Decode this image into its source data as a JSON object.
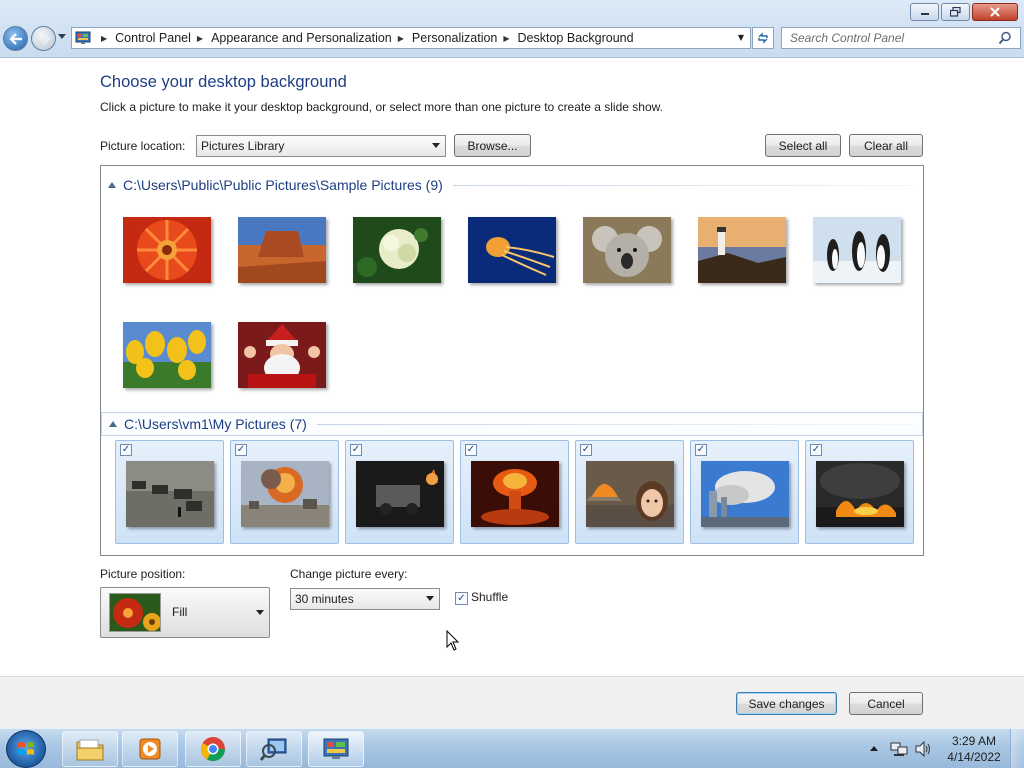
{
  "window": {
    "minimize_label": "Minimize",
    "maximize_label": "Restore",
    "close_label": "Close"
  },
  "address_bar": {
    "breadcrumbs": [
      "Control Panel",
      "Appearance and Personalization",
      "Personalization",
      "Desktop Background"
    ]
  },
  "search": {
    "placeholder": "Search Control Panel"
  },
  "page": {
    "title": "Choose your desktop background",
    "subtitle": "Click a picture to make it your desktop background, or select more than one picture to create a slide show."
  },
  "picture_location": {
    "label": "Picture location:",
    "value": "Pictures Library",
    "browse_label": "Browse...",
    "select_all_label": "Select all",
    "clear_all_label": "Clear all"
  },
  "groups": [
    {
      "name": "C:\\Users\\Public\\Public Pictures\\Sample Pictures (9)",
      "pictures": [
        {
          "name": "Chrysanthemum",
          "checked": false
        },
        {
          "name": "Desert",
          "checked": false
        },
        {
          "name": "Hydrangeas",
          "checked": false
        },
        {
          "name": "Jellyfish",
          "checked": false
        },
        {
          "name": "Koala",
          "checked": false
        },
        {
          "name": "Lighthouse",
          "checked": false
        },
        {
          "name": "Penguins",
          "checked": false
        },
        {
          "name": "Tulips",
          "checked": false
        },
        {
          "name": "Santa",
          "checked": false
        }
      ]
    },
    {
      "name": "C:\\Users\\vm1\\My Pictures (7)",
      "pictures": [
        {
          "name": "Tanks",
          "checked": true
        },
        {
          "name": "Explosion",
          "checked": true
        },
        {
          "name": "Riot",
          "checked": true
        },
        {
          "name": "Mushroom cloud",
          "checked": true
        },
        {
          "name": "House fire girl",
          "checked": true
        },
        {
          "name": "Towers smoke",
          "checked": true
        },
        {
          "name": "Oil fire",
          "checked": true
        }
      ]
    }
  ],
  "picture_position": {
    "label": "Picture position:",
    "value": "Fill"
  },
  "change_picture": {
    "label": "Change picture every:",
    "value": "30 minutes"
  },
  "shuffle": {
    "label": "Shuffle",
    "checked": true
  },
  "footer": {
    "save_label": "Save changes",
    "cancel_label": "Cancel"
  },
  "taskbar": {
    "items": [
      "windows-explorer",
      "media-player",
      "chrome",
      "network-tool",
      "control-panel"
    ],
    "time": "3:29 AM",
    "date": "4/14/2022"
  },
  "colors": {
    "title": "#1d3e82",
    "selected_tile": "#cfe2f6",
    "taskbar": "#a8c6e3"
  }
}
